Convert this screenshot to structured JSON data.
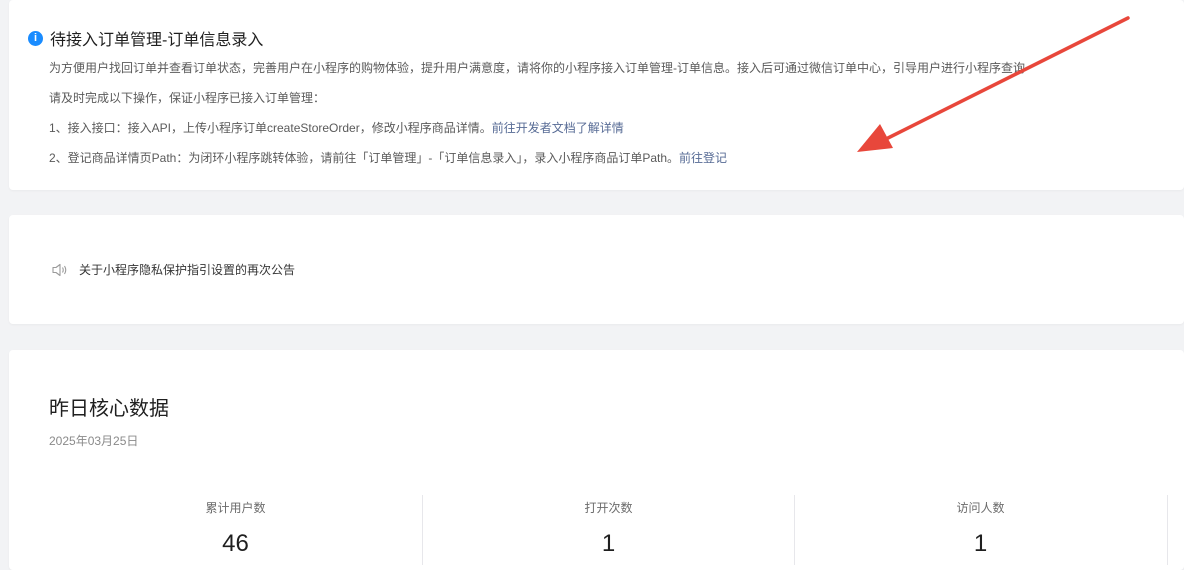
{
  "notice": {
    "title": "待接入订单管理-订单信息录入",
    "description": "为方便用户找回订单并查看订单状态，完善用户在小程序的购物体验，提升用户满意度，请将你的小程序接入订单管理-订单信息。接入后可通过微信订单中心，引导用户进行小程序查询",
    "prompt": "请及时完成以下操作，保证小程序已接入订单管理：",
    "step1_text": "1、接入接口：接入API，上传小程序订单createStoreOrder，修改小程序商品详情。",
    "step1_link": "前往开发者文档了解详情",
    "step2_text": "2、登记商品详情页Path：为闭环小程序跳转体验，请前往「订单管理」-「订单信息录入」，录入小程序商品订单Path。",
    "step2_link": "前往登记",
    "info_icon": "info-icon",
    "info_glyph": "i",
    "accent_color": "#1a8cff",
    "link_color": "#576b95"
  },
  "announcement": {
    "icon": "speaker-icon",
    "text": "关于小程序隐私保护指引设置的再次公告"
  },
  "core_data": {
    "title": "昨日核心数据",
    "date": "2025年03月25日",
    "metrics": [
      {
        "label": "累计用户数",
        "value": "46"
      },
      {
        "label": "打开次数",
        "value": "1"
      },
      {
        "label": "访问人数",
        "value": "1"
      }
    ]
  },
  "annotation": {
    "arrow_color": "#e8473b"
  }
}
